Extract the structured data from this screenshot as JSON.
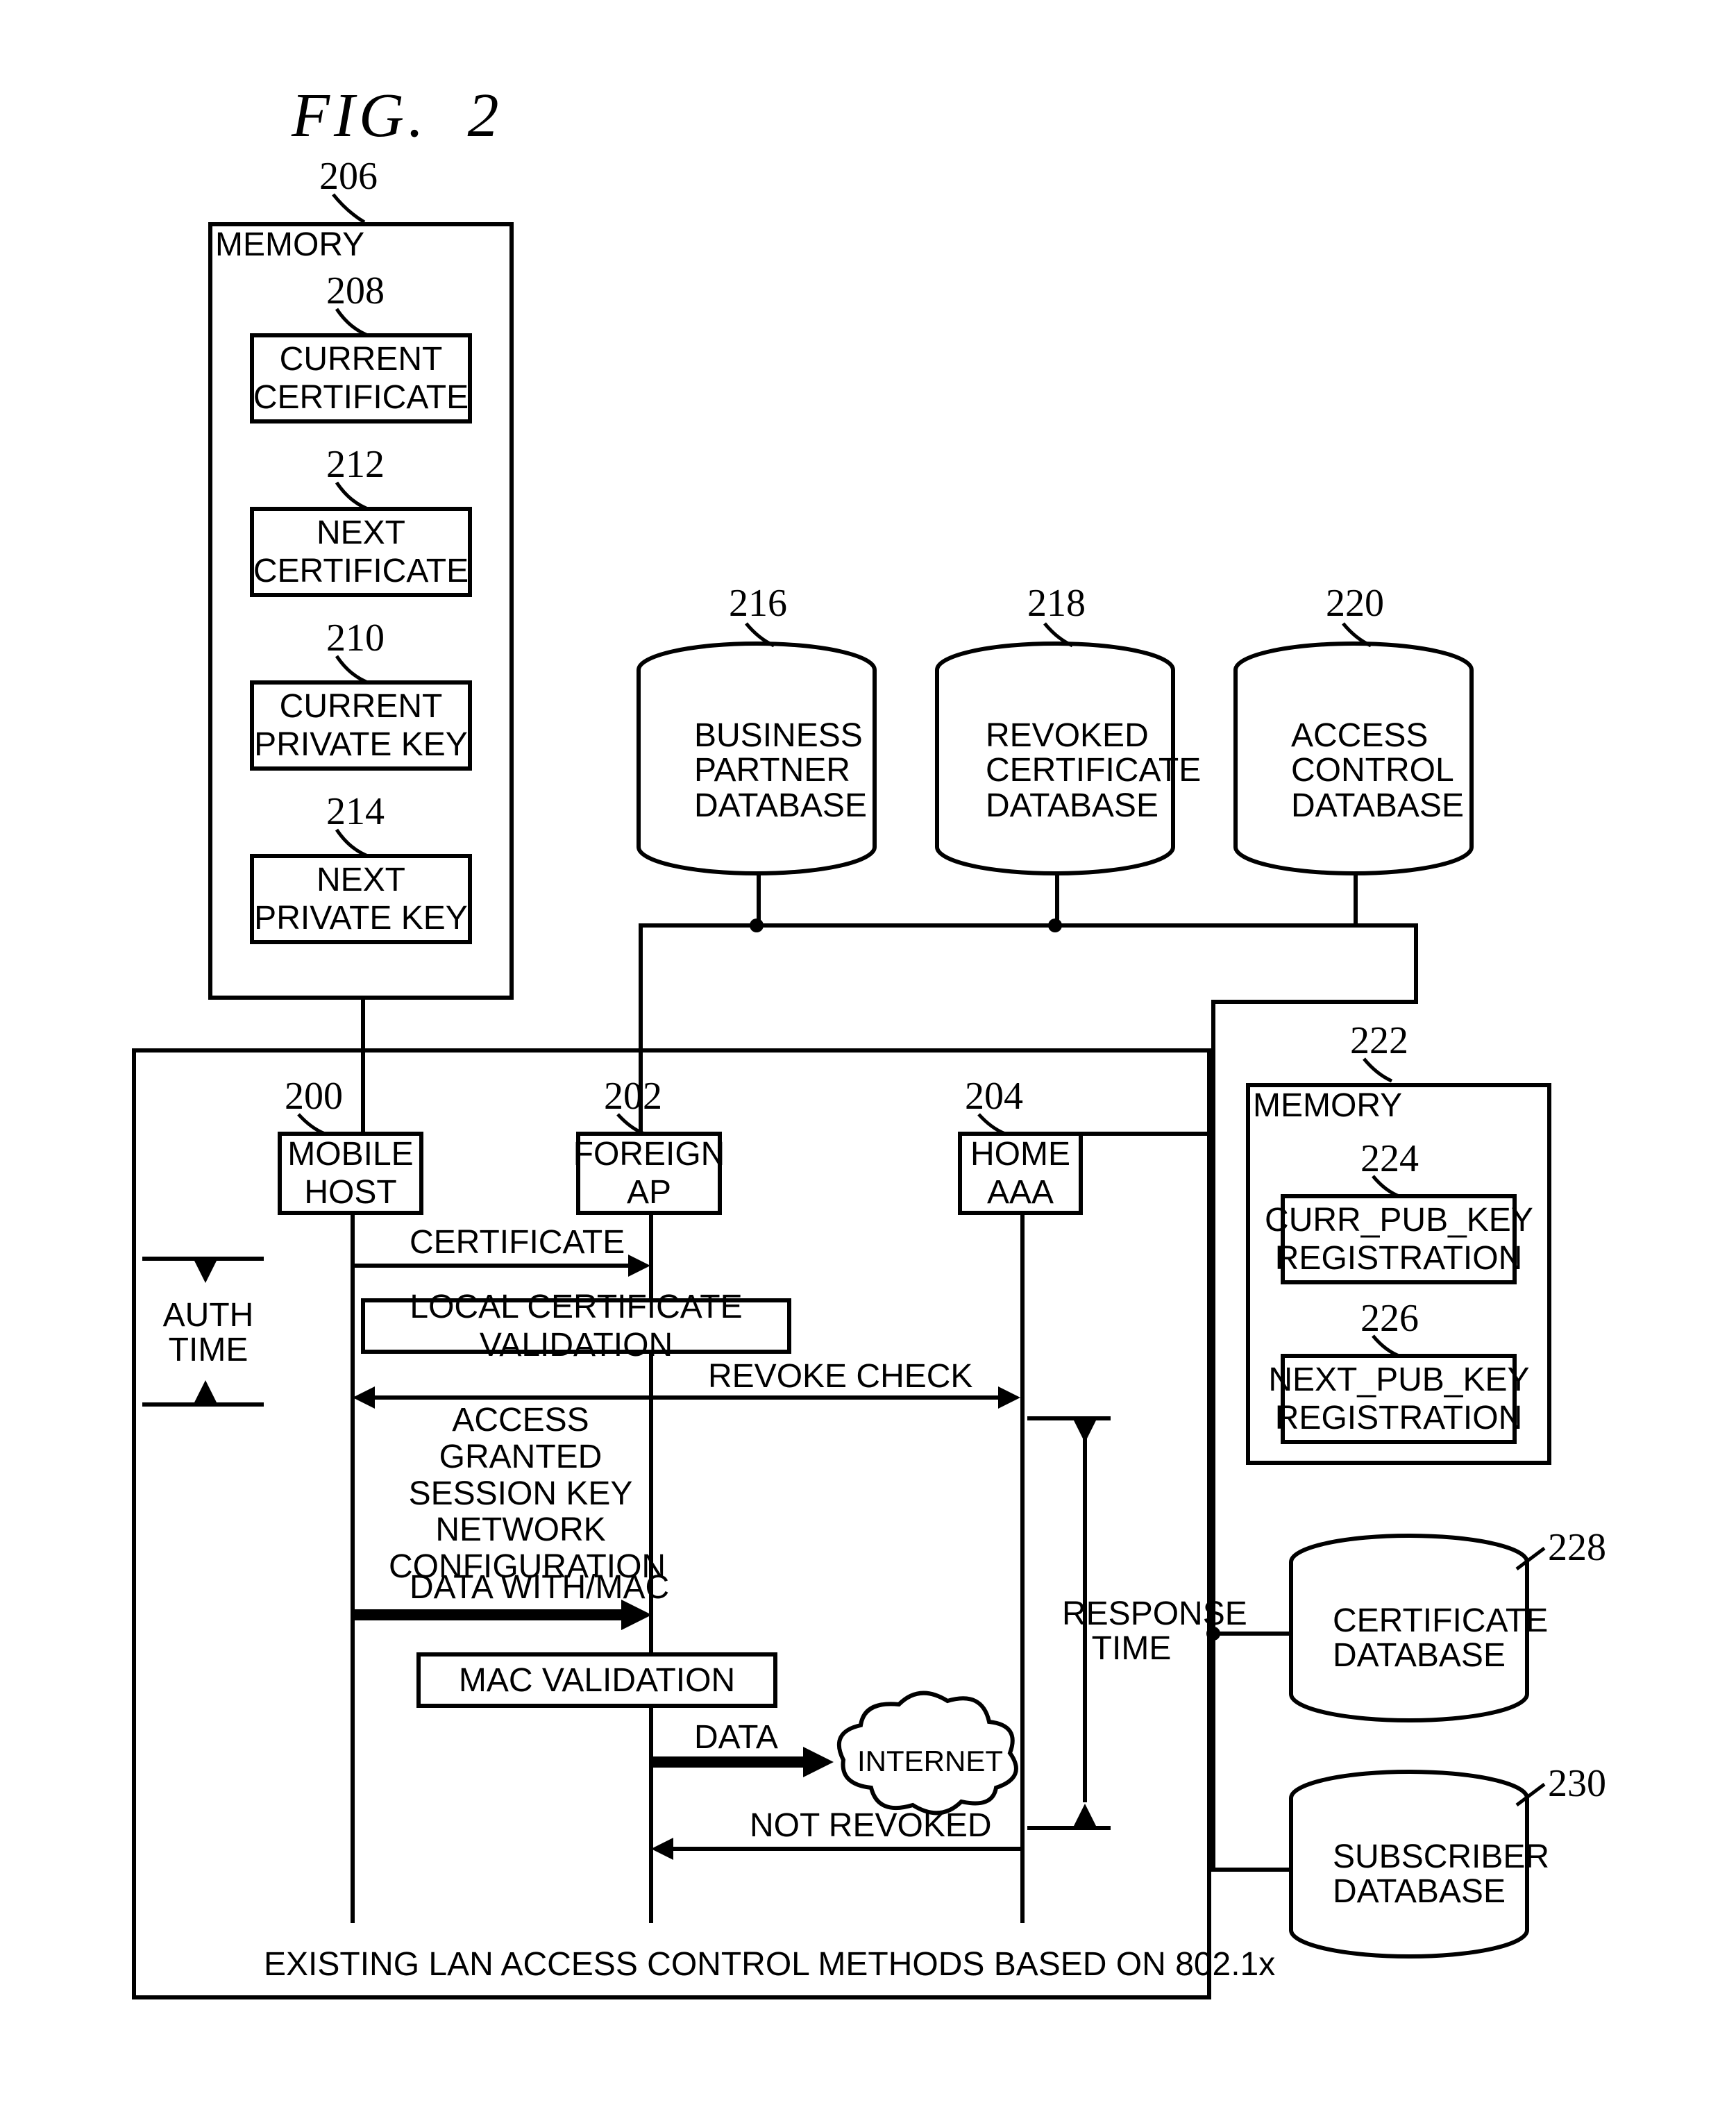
{
  "title": "FIG.  2",
  "refs": {
    "r206": "206",
    "r208": "208",
    "r212": "212",
    "r210": "210",
    "r214": "214",
    "r216": "216",
    "r218": "218",
    "r220": "220",
    "r222": "222",
    "r224": "224",
    "r226": "226",
    "r228": "228",
    "r230": "230",
    "r200": "200",
    "r202": "202",
    "r204": "204"
  },
  "memoryA": {
    "title": "MEMORY",
    "curr_cert": "CURRENT\nCERTIFICATE",
    "next_cert": "NEXT\nCERTIFICATE",
    "curr_pk": "CURRENT\nPRIVATE KEY",
    "next_pk": "NEXT\nPRIVATE KEY"
  },
  "memoryB": {
    "title": "MEMORY",
    "curr_pub": "CURR_PUB_KEY\nREGISTRATION",
    "next_pub": "NEXT_PUB_KEY\nREGISTRATION"
  },
  "dbs": {
    "bpd": "BUSINESS\nPARTNER\nDATABASE",
    "rcd": "REVOKED\nCERTIFICATE\nDATABASE",
    "acd": "ACCESS\nCONTROL\nDATABASE",
    "certdb": "CERTIFICATE\nDATABASE",
    "subdb": "SUBSCRIBER\nDATABASE"
  },
  "nodes": {
    "mobile": "MOBILE\nHOST",
    "foreign": "FOREIGN\nAP",
    "home": "HOME\nAAA"
  },
  "seq": {
    "auth_time": "AUTH\nTIME",
    "certificate": "CERTIFICATE",
    "local_val": "LOCAL CERTIFICATE VALIDATION",
    "access_granted": "ACCESS GRANTED\nSESSION KEY NETWORK\nCONFIGURATION",
    "revoke_check": "REVOKE CHECK",
    "data_mac": "DATA WITH/MAC",
    "mac_val": "MAC VALIDATION",
    "data": "DATA",
    "internet": "INTERNET",
    "not_revoked": "NOT REVOKED",
    "resp_time": "RESPONSE\nTIME",
    "footer": "EXISTING LAN ACCESS CONTROL METHODS BASED ON 802.1x"
  }
}
